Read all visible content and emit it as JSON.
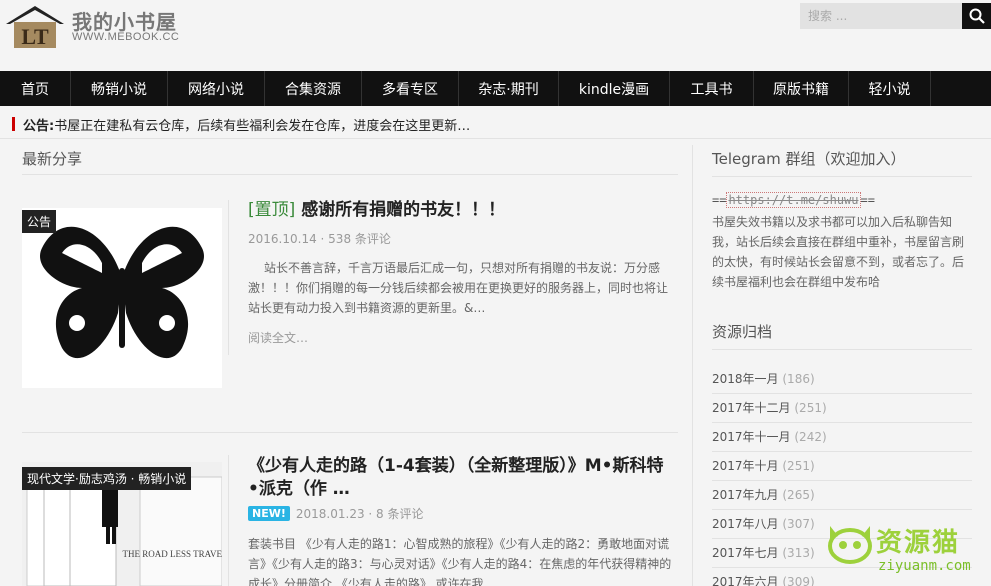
{
  "site": {
    "name": "我的小书屋",
    "url_text": "WWW.MEBOOK.CC",
    "logo_letters": "LT"
  },
  "search": {
    "placeholder": "搜索 ..."
  },
  "nav": {
    "items": [
      "首页",
      "畅销小说",
      "网络小说",
      "合集资源",
      "多看专区",
      "杂志·期刊",
      "kindle漫画",
      "工具书",
      "原版书籍",
      "轻小说"
    ]
  },
  "notice": {
    "label": "公告:",
    "text": "书屋正在建私有云仓库，后续有些福利会发在仓库，进度会在这里更新…"
  },
  "main": {
    "section_title": "最新分享",
    "posts": [
      {
        "tag": "公告",
        "pin": "[置顶]",
        "title": "感谢所有捐赠的书友！！！",
        "date": "2016.10.14",
        "comments": "538 条评论",
        "excerpt": "站长不善言辞，千言万语最后汇成一句，只想对所有捐赠的书友说：万分感激！！！你们捐赠的每一分钱后续都会被用在更换更好的服务器上，同时也将让站长更有动力投入到书籍资源的更新里。&…",
        "readmore": "阅读全文…"
      },
      {
        "tag": "现代文学·励志鸡汤 · 畅销小说",
        "badge": "NEW!",
        "title": "《少有人走的路（1-4套装）（全新整理版）》M•斯科特•派克（作 …",
        "date": "2018.01.23",
        "comments": "8 条评论",
        "excerpt": "套装书目 《少有人走的路1：心智成熟的旅程》《少有人走的路2：勇敢地面对谎言》《少有人走的路3：与心灵对话》《少有人走的路4：在焦虑的年代获得精神的成长》分册简介 《少有人走的路》 或许在我",
        "cover_text": "THE ROAD LESS TRAVELED"
      }
    ]
  },
  "sidebar": {
    "telegram_title": "Telegram 群组（欢迎加入）",
    "telegram_link": "https://t.me/shuwu",
    "telegram_text": "书屋失效书籍以及求书都可以加入后私聊告知我，站长后续会直接在群组中重补，书屋留言刷的太快，有时候站长会留意不到，或者忘了。后续书屋福利也会在群组中发布哈",
    "archive_title": "资源归档",
    "archives": [
      {
        "month": "2018年一月",
        "count": "(186)"
      },
      {
        "month": "2017年十二月",
        "count": "(251)"
      },
      {
        "month": "2017年十一月",
        "count": "(242)"
      },
      {
        "month": "2017年十月",
        "count": "(251)"
      },
      {
        "month": "2017年九月",
        "count": "(265)"
      },
      {
        "month": "2017年八月",
        "count": "(307)"
      },
      {
        "month": "2017年七月",
        "count": "(313)"
      },
      {
        "month": "2017年六月",
        "count": "(309)"
      }
    ]
  },
  "watermark": {
    "text": "资源猫",
    "url": "ziyuanm.com"
  }
}
